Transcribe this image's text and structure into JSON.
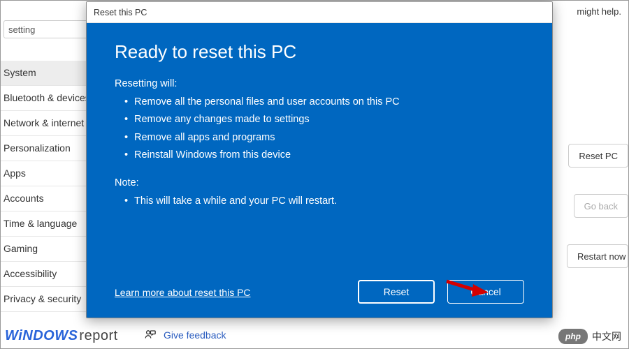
{
  "bg": {
    "help_text": "might help.",
    "search_value": "setting",
    "feedback_label": "Give feedback",
    "buttons": {
      "reset_pc": "Reset PC",
      "go_back": "Go back",
      "restart": "Restart now"
    }
  },
  "sidebar": {
    "items": [
      {
        "label": "System",
        "selected": true
      },
      {
        "label": "Bluetooth & devices",
        "selected": false
      },
      {
        "label": "Network & internet",
        "selected": false
      },
      {
        "label": "Personalization",
        "selected": false
      },
      {
        "label": "Apps",
        "selected": false
      },
      {
        "label": "Accounts",
        "selected": false
      },
      {
        "label": "Time & language",
        "selected": false
      },
      {
        "label": "Gaming",
        "selected": false
      },
      {
        "label": "Accessibility",
        "selected": false
      },
      {
        "label": "Privacy & security",
        "selected": false
      }
    ]
  },
  "dialog": {
    "titlebar": "Reset this PC",
    "heading": "Ready to reset this PC",
    "section1_label": "Resetting will:",
    "bullets1": [
      "Remove all the personal files and user accounts on this PC",
      "Remove any changes made to settings",
      "Remove all apps and programs",
      "Reinstall Windows from this device"
    ],
    "section2_label": "Note:",
    "bullets2": [
      "This will take a while and your PC will restart."
    ],
    "learn_more": "Learn more about reset this PC",
    "reset_btn": "Reset",
    "cancel_btn": "Cancel"
  },
  "watermarks": {
    "wr_part1": "WiNDOWS",
    "wr_part2": "report",
    "php_badge": "php",
    "php_text": "中文网"
  },
  "colors": {
    "dialog_bg": "#0067c0",
    "accent_link": "#2a5cbf"
  }
}
